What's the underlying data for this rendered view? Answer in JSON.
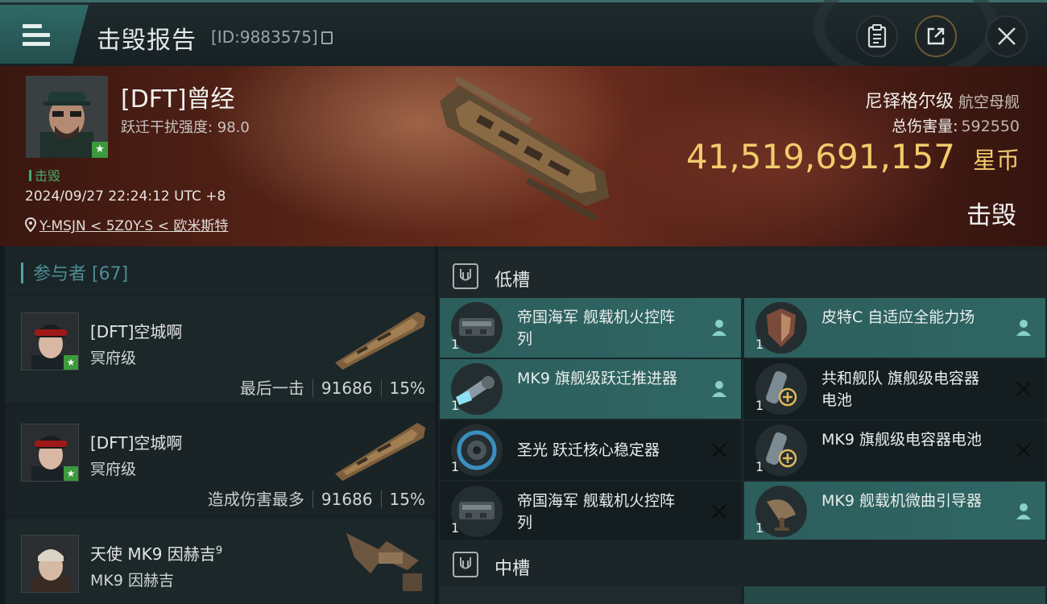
{
  "header": {
    "title": "击毁报告",
    "report_id": "[ID:9883575]"
  },
  "victim": {
    "name": "[DFT]曾经",
    "warp_disrupt": "跃迁干扰强度: 98.0",
    "status_tag": "击毁",
    "datetime": "2024/09/27 22:24:12 UTC +8",
    "location": "Y-MSJN < 5Z0Y-S < 欧米斯特",
    "ship_name": "尼铎格尔级",
    "ship_class": "航空母舰",
    "damage_label": "总伤害量:",
    "damage_value": "592550",
    "isk_value": "41,519,691,157",
    "isk_unit": "星币",
    "result": "击毁"
  },
  "participants": {
    "label": "参与者",
    "count": "[67]",
    "items": [
      {
        "name": "[DFT]空城啊",
        "ship": "冥府级",
        "role": "最后一击",
        "damage": "91686",
        "percent": "15%"
      },
      {
        "name": "[DFT]空城啊",
        "ship": "冥府级",
        "role": "造成伤害最多",
        "damage": "91686",
        "percent": "15%"
      },
      {
        "name": "天使 MK9 因赫吉",
        "name_sup": "9",
        "ship": "MK9 因赫吉"
      }
    ]
  },
  "fitting": {
    "low_slot_title": "低槽",
    "mid_slot_title": "中槽",
    "low_slots": [
      {
        "name": "帝国海军 舰载机火控阵列",
        "qty": "1",
        "status": "fitted-person"
      },
      {
        "name": "皮特C 自适应全能力场",
        "qty": "1",
        "status": "fitted-person"
      },
      {
        "name": "MK9 旗舰级跃迁推进器",
        "qty": "1",
        "status": "fitted-person"
      },
      {
        "name": "共和舰队 旗舰级电容器电池",
        "qty": "1",
        "status": "destroyed"
      },
      {
        "name": "圣光 跃迁核心稳定器",
        "qty": "1",
        "status": "destroyed"
      },
      {
        "name": "MK9 旗舰级电容器电池",
        "qty": "1",
        "status": "destroyed"
      },
      {
        "name": "帝国海军 舰载机火控阵列",
        "qty": "1",
        "status": "destroyed"
      },
      {
        "name": "MK9 舰载机微曲引导器",
        "qty": "1",
        "status": "fitted-person"
      }
    ]
  },
  "colors": {
    "accent_teal": "#2f6663",
    "isk_gold": "#f2cb6c",
    "kill_green": "#3fae6a"
  },
  "icons": [
    "menu-icon",
    "clipboard-icon",
    "share-icon",
    "close-icon",
    "location-pin-icon",
    "copy-icon",
    "slot-icon",
    "person-icon",
    "destroyed-x-icon"
  ]
}
